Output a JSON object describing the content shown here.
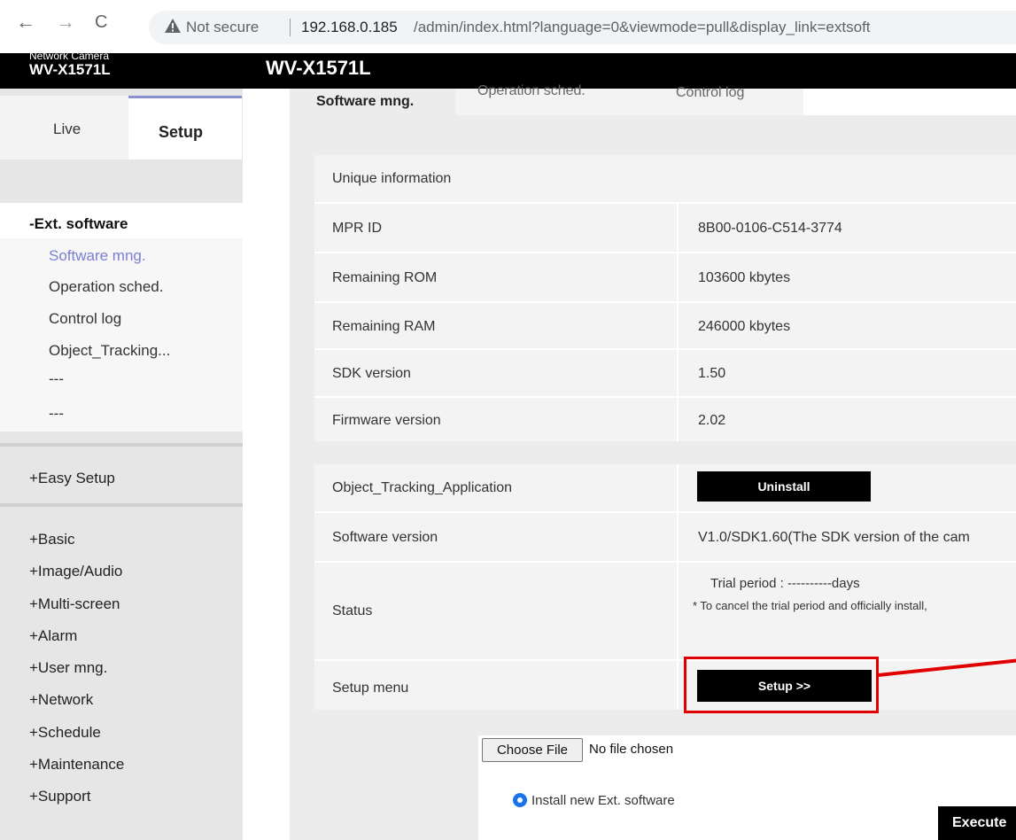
{
  "browser": {
    "back": "←",
    "forward": "→",
    "reload": "C",
    "security_warning": "Not secure",
    "url_host": "192.168.0.185",
    "url_path": "/admin/index.html?language=0&viewmode=pull&display_link=extsoft"
  },
  "camera": {
    "label": "Network Camera",
    "model_small": "WV-X1571L",
    "model": "WV-X1571L"
  },
  "sidebar": {
    "tabs": {
      "live": "Live",
      "setup": "Setup"
    },
    "ext_software_header": "-Ext. software",
    "ext_software_items": [
      {
        "label": "Software mng.",
        "active": true
      },
      {
        "label": "Operation sched."
      },
      {
        "label": "Control log"
      },
      {
        "label": "Object_Tracking..."
      },
      {
        "label": "---"
      },
      {
        "label": "---"
      }
    ],
    "easy_setup": "+Easy Setup",
    "groups": [
      "+Basic",
      "+Image/Audio",
      "+Multi-screen",
      "+Alarm",
      "+User mng.",
      "+Network",
      "+Schedule",
      "+Maintenance",
      "+Support"
    ]
  },
  "main_tabs": [
    "Software mng.",
    "Operation sched.",
    "Control log"
  ],
  "unique_info": {
    "header": "Unique information",
    "rows": [
      {
        "label": "MPR ID",
        "value": "8B00-0106-C514-3774"
      },
      {
        "label": "Remaining ROM",
        "value": "103600 kbytes"
      },
      {
        "label": "Remaining RAM",
        "value": "246000 kbytes"
      },
      {
        "label": "SDK version",
        "value": "1.50"
      },
      {
        "label": "Firmware version",
        "value": "2.02"
      }
    ]
  },
  "app": {
    "name": "Object_Tracking_Application",
    "uninstall_label": "Uninstall",
    "software_version_label": "Software version",
    "software_version_value": "V1.0/SDK1.60(The SDK version of the cam",
    "status_label": "Status",
    "status_trial": "Trial period : ----------days",
    "status_note": "* To cancel the trial period and officially install,",
    "setup_menu_label": "Setup menu",
    "setup_button": "Setup >>"
  },
  "install": {
    "choose_file": "Choose File",
    "no_file": "No file chosen",
    "radio_label": "Install new Ext. software",
    "execute": "Execute"
  },
  "colors": {
    "annotation_red": "#e00000",
    "active_link": "#7a7fcf"
  }
}
